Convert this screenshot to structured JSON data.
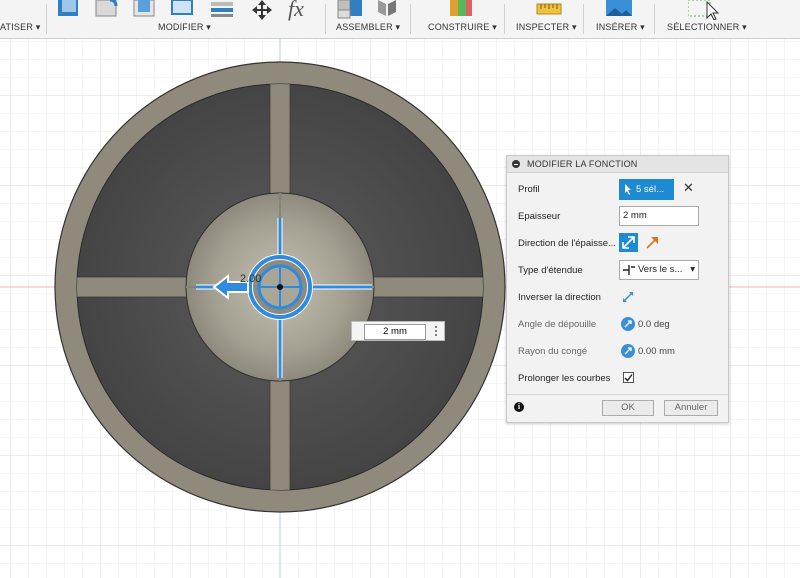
{
  "toolbar": {
    "groups": [
      {
        "label": "ATISER ▾"
      },
      {
        "label": "MODIFIER ▾"
      },
      {
        "label": "ASSEMBLER ▾"
      },
      {
        "label": "CONSTRUIRE ▾"
      },
      {
        "label": "INSPECTER ▾"
      },
      {
        "label": "INSÉRER ▾"
      },
      {
        "label": "SÉLECTIONNER ▾"
      }
    ],
    "fx_glyph": "fx"
  },
  "viewport": {
    "dim_label": "2.00",
    "dim_input_value": "2 mm"
  },
  "dialog": {
    "title": "MODIFIER LA FONCTION",
    "rows": {
      "profil": {
        "label": "Profil",
        "value": "5 sél..."
      },
      "epaisseur": {
        "label": "Epaisseur",
        "value": "2 mm"
      },
      "direction": {
        "label": "Direction de l'épaisse..."
      },
      "type_etendue": {
        "label": "Type d'étendue",
        "value": "Vers le s..."
      },
      "inverser": {
        "label": "Inverser la direction"
      },
      "angle": {
        "label": "Angle de dépouille",
        "value": "0.0 deg"
      },
      "rayon": {
        "label": "Rayon du congé",
        "value": "0.00 mm"
      },
      "prolonger": {
        "label": "Prolonger les courbes",
        "checked": true
      }
    },
    "ok_label": "OK",
    "cancel_label": "Annuler"
  },
  "colors": {
    "accent": "#1e8ad2",
    "model_light": "#8f8a7b",
    "model_dark": "#4e4e4e",
    "grid": "#e3e3e3"
  }
}
